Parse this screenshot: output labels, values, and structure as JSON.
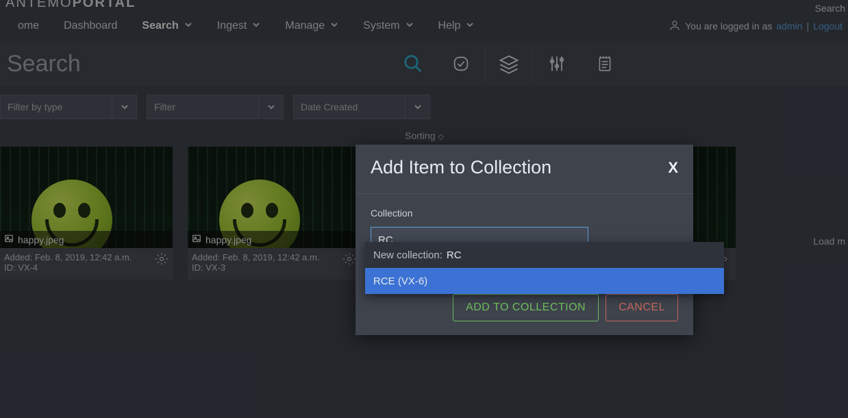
{
  "brand": {
    "text_light": "ANTEMO",
    "text_bold": "PORTAL"
  },
  "top_search_link": "Search",
  "nav": {
    "items": [
      {
        "label": "ome",
        "dropdown": false
      },
      {
        "label": "Dashboard",
        "dropdown": false
      },
      {
        "label": "Search",
        "dropdown": true,
        "active": true
      },
      {
        "label": "Ingest",
        "dropdown": true
      },
      {
        "label": "Manage",
        "dropdown": true
      },
      {
        "label": "System",
        "dropdown": true
      },
      {
        "label": "Help",
        "dropdown": true
      }
    ]
  },
  "user": {
    "prefix": "You are logged in as",
    "name": "admin",
    "logout": "Logout"
  },
  "search": {
    "placeholder": "Search",
    "value": ""
  },
  "filters": [
    {
      "label": "Filter by type"
    },
    {
      "label": "Filter"
    },
    {
      "label": "Date Created"
    }
  ],
  "sorting_label": "Sorting",
  "load_more": "Load m",
  "cards": [
    {
      "filename": "happy.jpeg",
      "added": "Added: Feb. 8, 2019, 12:42 a.m.",
      "id": "ID: VX-4"
    },
    {
      "filename": "happy.jpeg",
      "added": "Added: Feb. 8, 2019, 12:42 a.m.",
      "id": "ID: VX-3"
    },
    {
      "filename": "",
      "added": "",
      "id": ""
    },
    {
      "filename": "",
      "added": "",
      "id": ""
    }
  ],
  "modal": {
    "title": "Add Item to Collection",
    "close": "X",
    "field_label": "Collection",
    "input_value": "RC",
    "options": {
      "new_prefix": "New collection:",
      "new_value": "RC",
      "match": "RCE (VX-6)"
    },
    "add_btn": "ADD TO COLLECTION",
    "cancel_btn": "CANCEL"
  }
}
